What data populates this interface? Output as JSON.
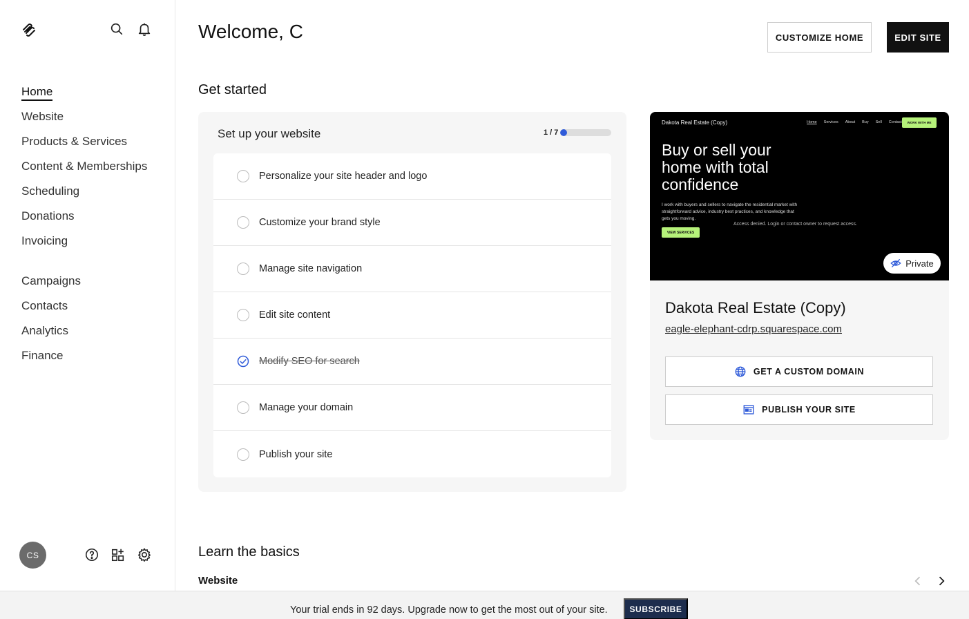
{
  "sidebar": {
    "logo_icon": "squarespace-logo-icon",
    "top_icons": [
      "search-icon",
      "bell-icon"
    ],
    "nav_primary": [
      {
        "label": "Home",
        "active": true
      },
      {
        "label": "Website"
      },
      {
        "label": "Products & Services"
      },
      {
        "label": "Content & Memberships"
      },
      {
        "label": "Scheduling"
      },
      {
        "label": "Donations"
      },
      {
        "label": "Invoicing"
      }
    ],
    "nav_secondary": [
      {
        "label": "Campaigns"
      },
      {
        "label": "Contacts"
      },
      {
        "label": "Analytics"
      },
      {
        "label": "Finance"
      }
    ],
    "avatar_initials": "CS",
    "bottom_icons": [
      "help-icon",
      "extensions-icon",
      "settings-icon"
    ]
  },
  "header": {
    "welcome": "Welcome, C",
    "customize_home_label": "CUSTOMIZE HOME",
    "edit_site_label": "EDIT SITE"
  },
  "get_started": {
    "title": "Get started",
    "setup": {
      "title": "Set up your website",
      "progress_text": "1 / 7",
      "progress_fraction": 0.14,
      "tasks": [
        {
          "label": "Personalize your site header and logo",
          "done": false
        },
        {
          "label": "Customize your brand style",
          "done": false
        },
        {
          "label": "Manage site navigation",
          "done": false
        },
        {
          "label": "Edit site content",
          "done": false
        },
        {
          "label": "Modify SEO for search",
          "done": true
        },
        {
          "label": "Manage your domain",
          "done": false
        },
        {
          "label": "Publish your site",
          "done": false
        }
      ]
    },
    "site": {
      "preview": {
        "brand": "Dakota Real Estate (Copy)",
        "nav": [
          "Home",
          "Services",
          "About",
          "Buy",
          "Sell",
          "Contact"
        ],
        "cta": "WORK WITH ME",
        "headline": "Buy or sell your home with total confidence",
        "body": "I work with buyers and sellers to navigate the residential market with straightforward advice, industry best practices, and knowledge that gets you moving.",
        "denied": "Access denied. Login or contact owner to request access.",
        "button": "VIEW SERVICES"
      },
      "private_label": "Private",
      "name": "Dakota Real Estate (Copy)",
      "url": "eagle-elephant-cdrp.squarespace.com",
      "custom_domain_label": "GET A CUSTOM DOMAIN",
      "publish_label": "PUBLISH YOUR SITE"
    }
  },
  "learn": {
    "title": "Learn the basics",
    "subtitle": "Website"
  },
  "trial": {
    "text": "Your trial ends in 92 days. Upgrade now to get the most out of your site.",
    "subscribe_label": "SUBSCRIBE"
  },
  "colors": {
    "accent_blue": "#2f5bd9",
    "preview_green": "#b6f27a",
    "subscribe_navy": "#1d2d4d"
  }
}
